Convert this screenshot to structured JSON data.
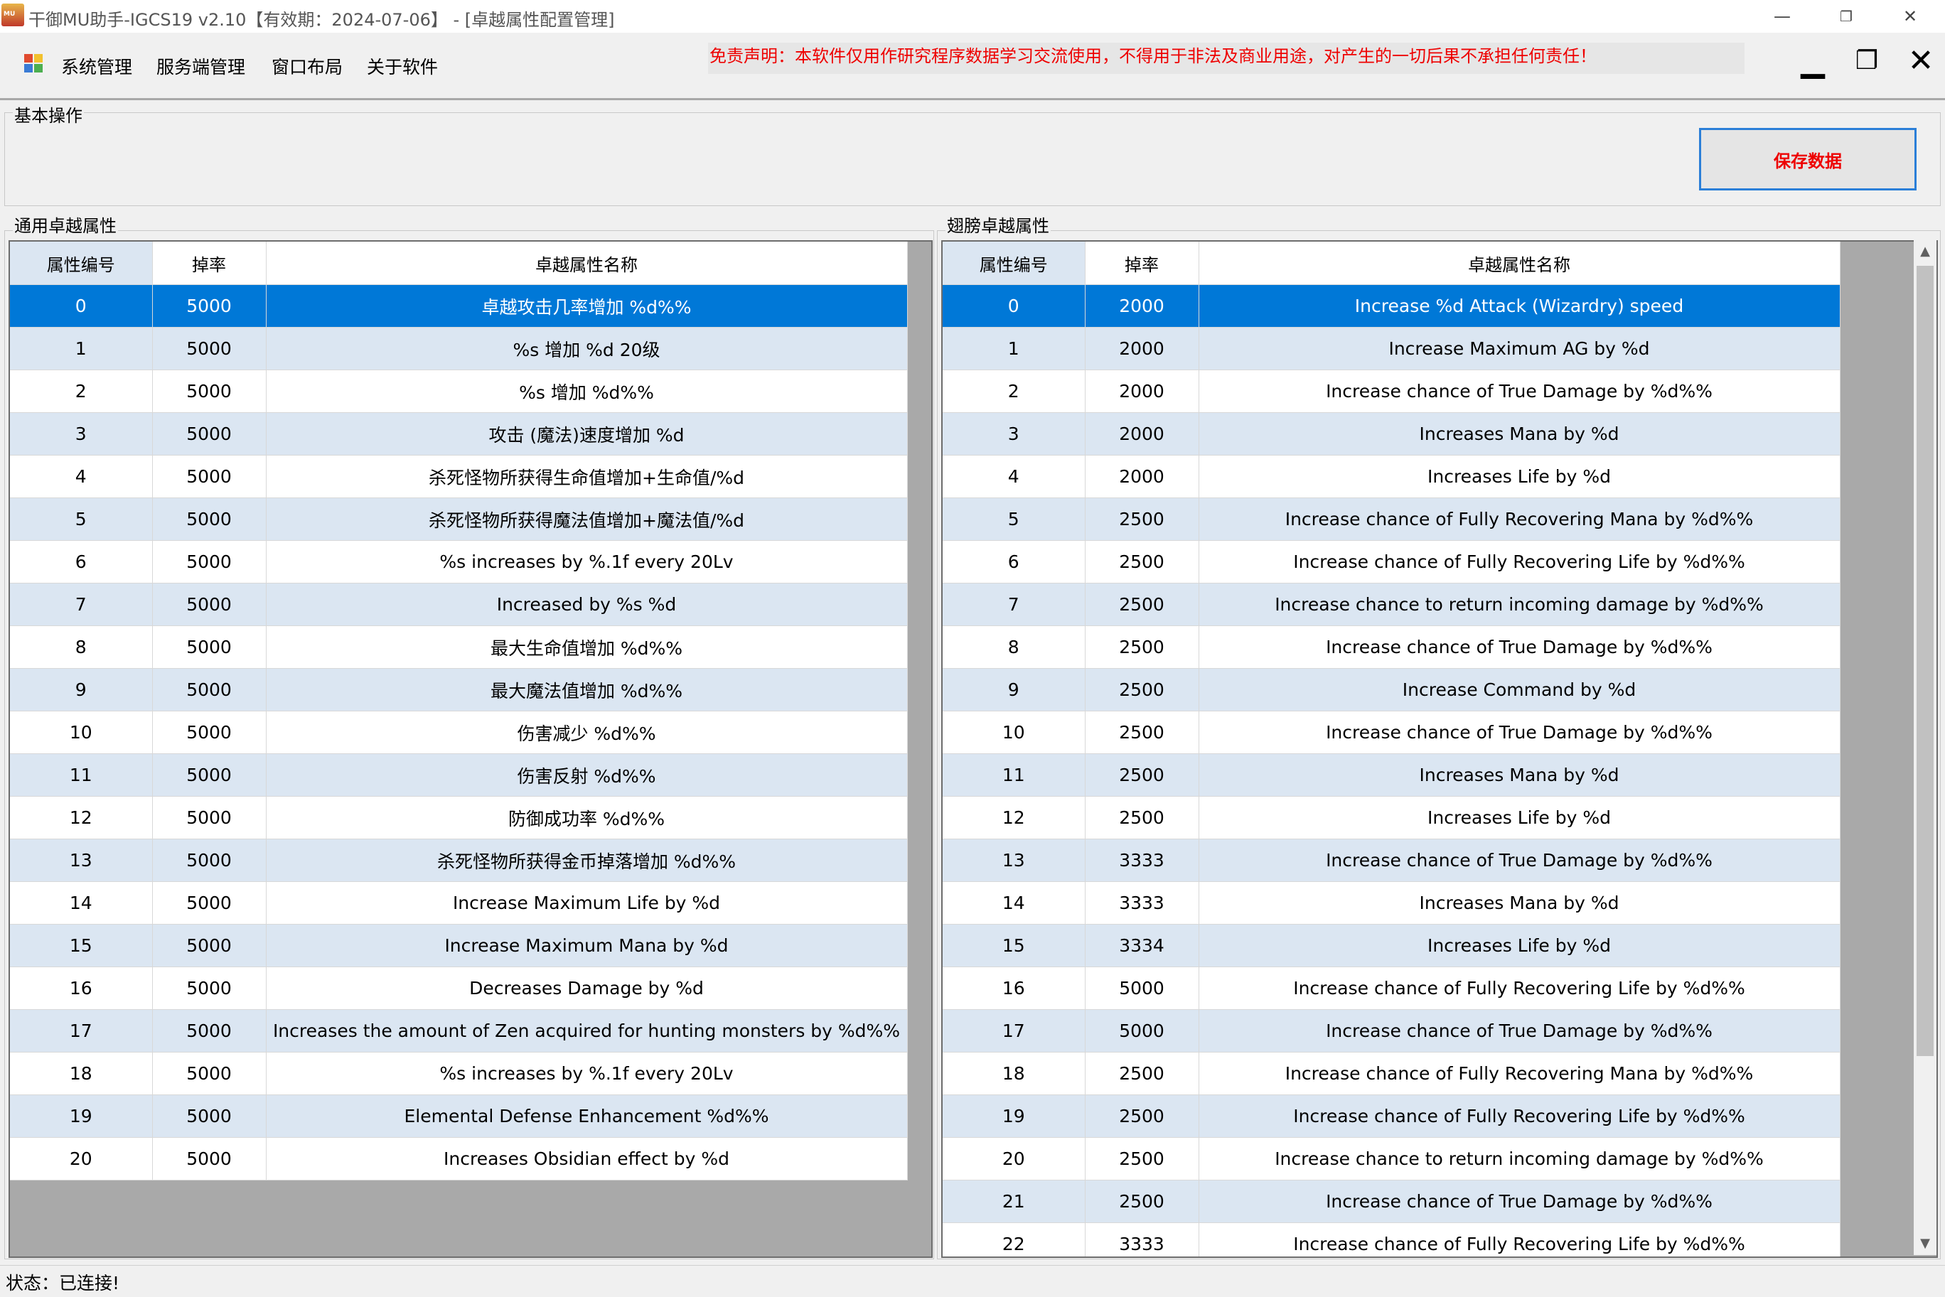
{
  "window": {
    "title": "干御MU助手-IGCS19 v2.10【有效期：2024-07-06】 - [卓越属性配置管理]",
    "minimize": "—",
    "restore": "❐",
    "close": "✕"
  },
  "menu": {
    "items": [
      "系统管理",
      "服务端管理",
      "窗口布局",
      "关于软件"
    ],
    "disclaimer": "免责声明：本软件仅用作研究程序数据学习交流使用，不得用于非法及商业用途，对产生的一切后果不承担任何责任！",
    "minimize": "▁",
    "restore": "❐",
    "close": "✕"
  },
  "basic_ops": {
    "label": "基本操作",
    "save_button": "保存数据"
  },
  "left_table": {
    "label": "通用卓越属性",
    "columns": [
      "属性编号",
      "掉率",
      "卓越属性名称"
    ],
    "rows": [
      [
        "0",
        "5000",
        "卓越攻击几率增加 %d%%"
      ],
      [
        "1",
        "5000",
        "%s 增加 %d 20级"
      ],
      [
        "2",
        "5000",
        "%s 增加 %d%%"
      ],
      [
        "3",
        "5000",
        "攻击 (魔法)速度增加 %d"
      ],
      [
        "4",
        "5000",
        "杀死怪物所获得生命值增加+生命值/%d"
      ],
      [
        "5",
        "5000",
        "杀死怪物所获得魔法值增加+魔法值/%d"
      ],
      [
        "6",
        "5000",
        "%s increases by %.1f every 20Lv"
      ],
      [
        "7",
        "5000",
        "Increased by %s %d"
      ],
      [
        "8",
        "5000",
        "最大生命值增加 %d%%"
      ],
      [
        "9",
        "5000",
        "最大魔法值增加 %d%%"
      ],
      [
        "10",
        "5000",
        "伤害减少 %d%%"
      ],
      [
        "11",
        "5000",
        "伤害反射 %d%%"
      ],
      [
        "12",
        "5000",
        "防御成功率 %d%%"
      ],
      [
        "13",
        "5000",
        "杀死怪物所获得金币掉落增加 %d%%"
      ],
      [
        "14",
        "5000",
        "Increase Maximum Life by %d"
      ],
      [
        "15",
        "5000",
        "Increase Maximum Mana by %d"
      ],
      [
        "16",
        "5000",
        "Decreases Damage by %d"
      ],
      [
        "17",
        "5000",
        "Increases the amount of Zen acquired for hunting monsters by %d%%"
      ],
      [
        "18",
        "5000",
        "%s increases by %.1f every 20Lv"
      ],
      [
        "19",
        "5000",
        "Elemental Defense Enhancement %d%%"
      ],
      [
        "20",
        "5000",
        "Increases Obsidian effect by %d"
      ]
    ]
  },
  "right_table": {
    "label": "翅膀卓越属性",
    "columns": [
      "属性编号",
      "掉率",
      "卓越属性名称"
    ],
    "rows": [
      [
        "0",
        "2000",
        "Increase %d Attack (Wizardry) speed"
      ],
      [
        "1",
        "2000",
        "Increase Maximum AG by %d"
      ],
      [
        "2",
        "2000",
        "Increase chance of True Damage by %d%%"
      ],
      [
        "3",
        "2000",
        "Increases Mana by %d"
      ],
      [
        "4",
        "2000",
        "Increases Life by %d"
      ],
      [
        "5",
        "2500",
        "Increase chance of Fully Recovering Mana by %d%%"
      ],
      [
        "6",
        "2500",
        "Increase chance of Fully Recovering Life by %d%%"
      ],
      [
        "7",
        "2500",
        "Increase chance to return incoming damage by %d%%"
      ],
      [
        "8",
        "2500",
        "Increase chance of True Damage by %d%%"
      ],
      [
        "9",
        "2500",
        "Increase Command by %d"
      ],
      [
        "10",
        "2500",
        "Increase chance of True Damage by %d%%"
      ],
      [
        "11",
        "2500",
        "Increases Mana by %d"
      ],
      [
        "12",
        "2500",
        "Increases Life by %d"
      ],
      [
        "13",
        "3333",
        "Increase chance of True Damage by %d%%"
      ],
      [
        "14",
        "3333",
        "Increases Mana by %d"
      ],
      [
        "15",
        "3334",
        "Increases Life by %d"
      ],
      [
        "16",
        "5000",
        "Increase chance of Fully Recovering Life by %d%%"
      ],
      [
        "17",
        "5000",
        "Increase chance of True Damage by %d%%"
      ],
      [
        "18",
        "2500",
        "Increase chance of Fully Recovering Mana by %d%%"
      ],
      [
        "19",
        "2500",
        "Increase chance of Fully Recovering Life by %d%%"
      ],
      [
        "20",
        "2500",
        "Increase chance to return incoming damage by %d%%"
      ],
      [
        "21",
        "2500",
        "Increase chance of True Damage by %d%%"
      ],
      [
        "22",
        "3333",
        "Increase chance of Fully Recovering Life by %d%%"
      ]
    ]
  },
  "status": {
    "text": "状态：已连接!"
  },
  "colors": {
    "selected_row": "#0078d7",
    "alt_row": "#dbe6f2",
    "disclaimer": "#ee0000",
    "save_border": "#2b7fd8"
  }
}
